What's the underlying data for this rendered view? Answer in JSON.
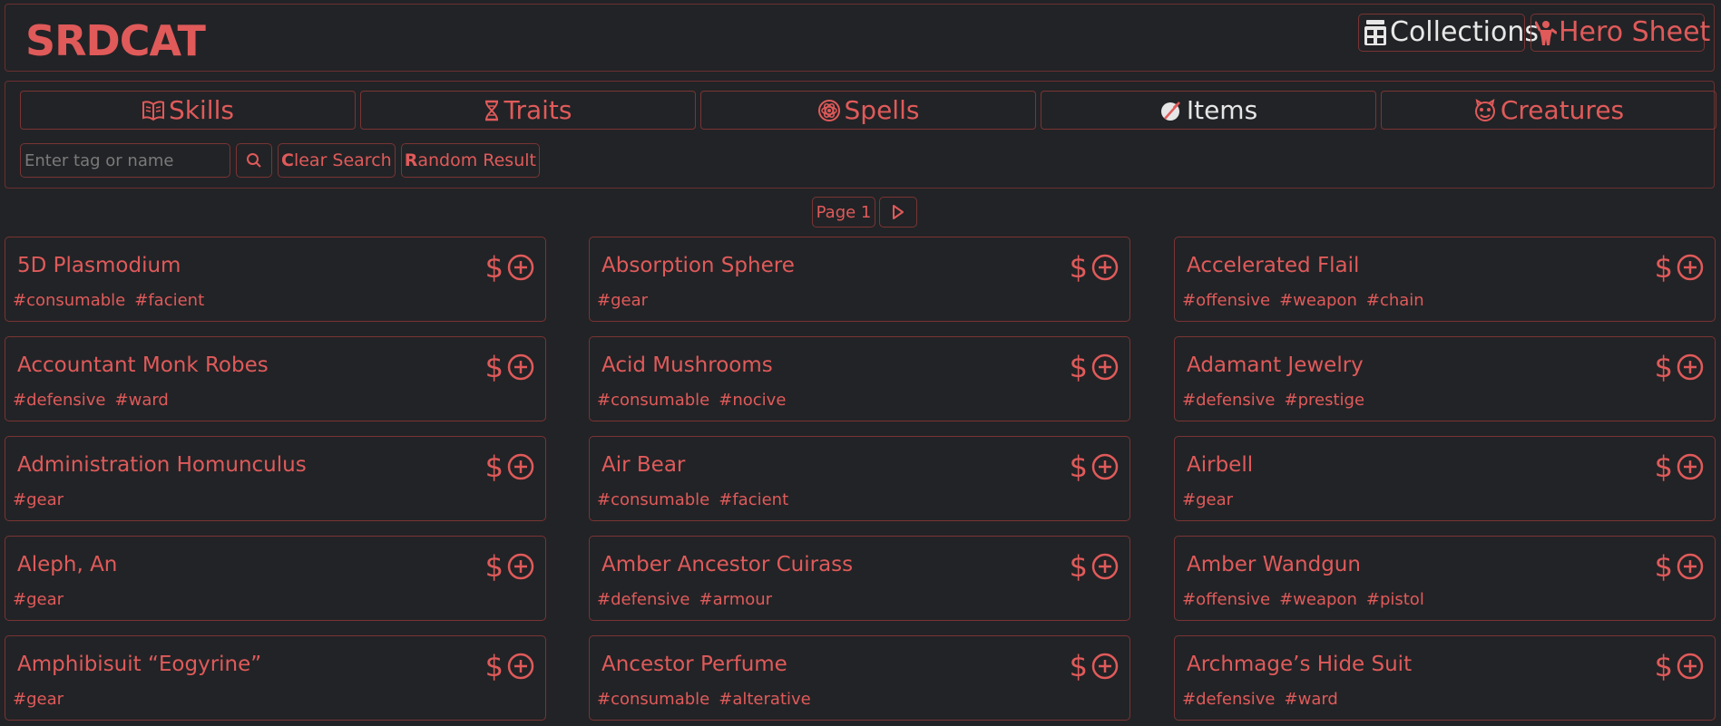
{
  "app": {
    "logo": "SRDCAT"
  },
  "header": {
    "collections_label": "Collections",
    "hero_label": "Hero Sheet"
  },
  "tabs": [
    {
      "label": "Skills",
      "icon": "book-icon",
      "active": false
    },
    {
      "label": "Traits",
      "icon": "dna-icon",
      "active": false
    },
    {
      "label": "Spells",
      "icon": "spell-atom-icon",
      "active": false
    },
    {
      "label": "Items",
      "icon": "potion-icon",
      "active": true
    },
    {
      "label": "Creatures",
      "icon": "creature-face-icon",
      "active": false
    }
  ],
  "search": {
    "placeholder": "Enter tag or name",
    "clear_label_first": "C",
    "clear_label_rest": "lear Search",
    "random_label_first": "R",
    "random_label_rest": "andom Result"
  },
  "pagination": {
    "label": "Page 1"
  },
  "items": [
    {
      "name": "5D Plasmodium",
      "tags": [
        "#consumable",
        "#facient"
      ]
    },
    {
      "name": "Absorption Sphere",
      "tags": [
        "#gear"
      ]
    },
    {
      "name": "Accelerated Flail",
      "tags": [
        "#offensive",
        "#weapon",
        "#chain"
      ]
    },
    {
      "name": "Accountant Monk Robes",
      "tags": [
        "#defensive",
        "#ward"
      ]
    },
    {
      "name": "Acid Mushrooms",
      "tags": [
        "#consumable",
        "#nocive"
      ]
    },
    {
      "name": "Adamant Jewelry",
      "tags": [
        "#defensive",
        "#prestige"
      ]
    },
    {
      "name": "Administration Homunculus",
      "tags": [
        "#gear"
      ]
    },
    {
      "name": "Air Bear",
      "tags": [
        "#consumable",
        "#facient"
      ]
    },
    {
      "name": "Airbell",
      "tags": [
        "#gear"
      ]
    },
    {
      "name": "Aleph, An",
      "tags": [
        "#gear"
      ]
    },
    {
      "name": "Amber Ancestor Cuirass",
      "tags": [
        "#defensive",
        "#armour"
      ]
    },
    {
      "name": "Amber Wandgun",
      "tags": [
        "#offensive",
        "#weapon",
        "#pistol"
      ]
    },
    {
      "name": "Amphibisuit “Eogyrine”",
      "tags": [
        "#gear"
      ]
    },
    {
      "name": "Ancestor Perfume",
      "tags": [
        "#consumable",
        "#alterative"
      ]
    },
    {
      "name": "Archmage’s Hide Suit",
      "tags": [
        "#defensive",
        "#ward"
      ]
    }
  ],
  "item_action_symbols": {
    "price": "$"
  },
  "colors": {
    "accent": "#e05a5a",
    "background": "#222326",
    "border": "#7a3434",
    "active_text": "#e6e6e6"
  }
}
